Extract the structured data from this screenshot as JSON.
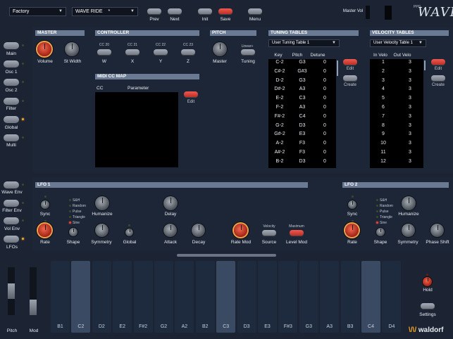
{
  "topbar": {
    "preset_bank": "Factory",
    "preset_name": "WAVE RIDE",
    "preset_mark": "*",
    "buttons": [
      "Prev",
      "Next",
      "Init",
      "Save",
      "Menu"
    ],
    "master_vol_label": "Master Vol",
    "logo_small": "PPG",
    "logo": "WAVE"
  },
  "sidebar_top": [
    "Main",
    "Osc 1",
    "Osc 2",
    "Filter",
    "Global",
    "Multi"
  ],
  "sidebar_bottom": [
    "Wave Env",
    "Filter Env",
    "Vol Env",
    "LFOs"
  ],
  "master": {
    "title": "MASTER",
    "knobs": [
      "Volume",
      "St Width"
    ]
  },
  "controller": {
    "title": "CONTROLLER",
    "ccs": [
      "CC 20",
      "CC 21",
      "CC 22",
      "CC 23"
    ],
    "names": [
      "W",
      "X",
      "Y",
      "Z"
    ]
  },
  "pitch": {
    "title": "PITCH",
    "knob": "Master",
    "mode": "Linear+",
    "tuning": "Tuning"
  },
  "midi_cc_map": {
    "title": "MIDI CC MAP",
    "col_cc": "CC",
    "col_param": "Parameter",
    "edit": "Edit"
  },
  "tuning": {
    "title": "TUNING TABLES",
    "selected": "User Tuning Table 1",
    "headers": [
      "Key",
      "Pitch",
      "Detune"
    ],
    "rows": [
      [
        "C-2",
        "G3",
        "0"
      ],
      [
        "C#-2",
        "G#3",
        "0"
      ],
      [
        "D-2",
        "G3",
        "0"
      ],
      [
        "D#-2",
        "A3",
        "0"
      ],
      [
        "E-2",
        "C3",
        "0"
      ],
      [
        "F-2",
        "A3",
        "0"
      ],
      [
        "F#-2",
        "C4",
        "0"
      ],
      [
        "G-2",
        "D3",
        "0"
      ],
      [
        "G#-2",
        "E3",
        "0"
      ],
      [
        "A-2",
        "F3",
        "0"
      ],
      [
        "A#-2",
        "F3",
        "0"
      ],
      [
        "B-2",
        "D3",
        "0"
      ]
    ],
    "edit": "Edit",
    "create": "Create"
  },
  "velocity": {
    "title": "VELOCITY TABLES",
    "selected": "User Velocity Table 1",
    "headers": [
      "In Velo",
      "Out Velo"
    ],
    "rows": [
      [
        "1",
        "3"
      ],
      [
        "2",
        "3"
      ],
      [
        "3",
        "3"
      ],
      [
        "4",
        "3"
      ],
      [
        "5",
        "3"
      ],
      [
        "6",
        "3"
      ],
      [
        "7",
        "3"
      ],
      [
        "8",
        "3"
      ],
      [
        "9",
        "3"
      ],
      [
        "10",
        "3"
      ],
      [
        "11",
        "3"
      ],
      [
        "12",
        "3"
      ]
    ],
    "edit": "Edit",
    "create": "Create"
  },
  "lfo1": {
    "title": "LFO 1",
    "sync": "Sync",
    "shapes": [
      "S&H",
      "Random",
      "Pulse",
      "Triangle",
      "Sine"
    ],
    "labels": [
      "Humanize",
      "Delay",
      "Rate",
      "Shape",
      "Symmetry",
      "Global",
      "Attack",
      "Decay",
      "Rate Mod",
      "Source",
      "Level Mod"
    ],
    "velocity": "Velocity",
    "maximum": "Maximum"
  },
  "lfo2": {
    "title": "LFO 2",
    "sync": "Sync",
    "shapes": [
      "S&H",
      "Random",
      "Pulse",
      "Triangle",
      "Sine"
    ],
    "labels": [
      "Humanize",
      "Rate",
      "Shape",
      "Symmetry",
      "Phase Shift"
    ]
  },
  "keyboard": {
    "keys": [
      "B1",
      "C2",
      "D2",
      "E2",
      "F#2",
      "G2",
      "A2",
      "B2",
      "C3",
      "D3",
      "E3",
      "F#3",
      "G3",
      "A3",
      "B3",
      "C4",
      "D4"
    ],
    "active": [
      1,
      8,
      15
    ]
  },
  "wheels": [
    "Pitch",
    "Mod"
  ],
  "hold": "Hold",
  "settings": "Settings",
  "brand": "waldorf",
  "colors": {
    "accent_red": "#e53b30",
    "panel_header": "#6a7a92",
    "led_on": "#f5a623"
  }
}
